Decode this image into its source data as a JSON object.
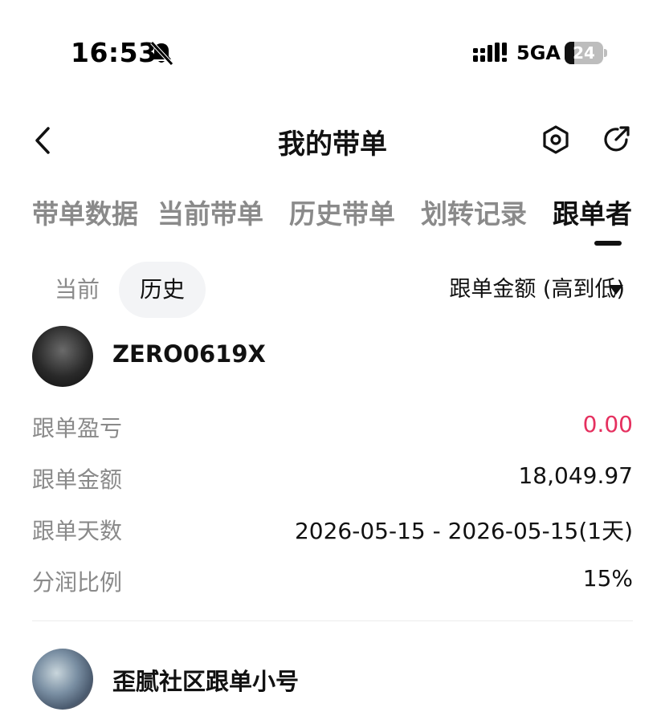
{
  "status_bar": {
    "time": "16:53",
    "network": "5GA",
    "battery_level": "24",
    "battery_fraction": 0.24
  },
  "header": {
    "title": "我的带单",
    "icons": [
      "back-icon",
      "settings-icon",
      "share-icon"
    ]
  },
  "tabs": [
    {
      "label": "带单数据",
      "active": false
    },
    {
      "label": "当前带单",
      "active": false
    },
    {
      "label": "历史带单",
      "active": false
    },
    {
      "label": "划转记录",
      "active": false
    },
    {
      "label": "跟单者",
      "active": true
    }
  ],
  "filters": {
    "current_label": "当前",
    "history_label": "历史",
    "selected": "历史",
    "sort_label": "跟单金额 (高到低)"
  },
  "followers": [
    {
      "username": "ZERO0619X",
      "rows": [
        {
          "label": "跟单盈亏",
          "value": "0.00"
        },
        {
          "label": "跟单金额",
          "value": "18,049.97"
        },
        {
          "label": "跟单天数",
          "value": "2026-05-15 - 2026-05-15(1天)"
        },
        {
          "label": "分润比例",
          "value": "15%"
        }
      ]
    },
    {
      "username": "歪腻社区跟单小号"
    }
  ],
  "colors": {
    "pnl": "#e5305f",
    "muted_text": "#8a8a8a",
    "primary_text": "#111111"
  }
}
